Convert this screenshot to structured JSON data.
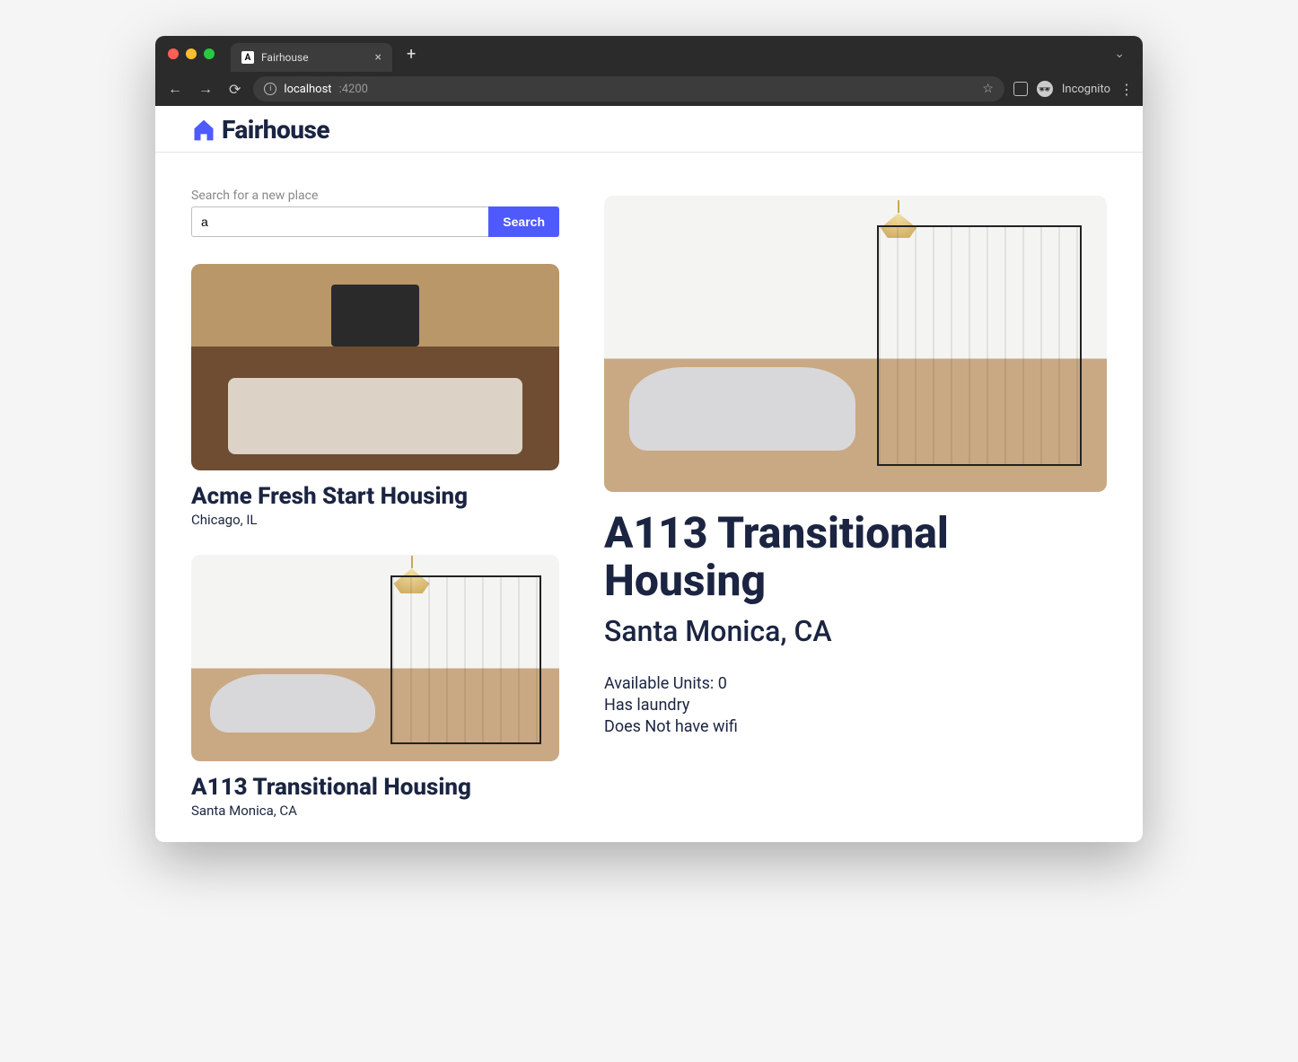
{
  "browser": {
    "tab_title": "Fairhouse",
    "tab_favicon_letter": "A",
    "url_host": "localhost",
    "url_port": ":4200",
    "incognito_label": "Incognito"
  },
  "app": {
    "brand": "Fairhouse"
  },
  "search": {
    "label": "Search for a new place",
    "value": "a",
    "button": "Search"
  },
  "listings": [
    {
      "name": "Acme Fresh Start Housing",
      "location": "Chicago, IL",
      "thumb": "room-a"
    },
    {
      "name": "A113 Transitional Housing",
      "location": "Santa Monica, CA",
      "thumb": "room-b"
    }
  ],
  "detail": {
    "name": "A113 Transitional Housing",
    "location": "Santa Monica, CA",
    "available_units_label": "Available Units: ",
    "available_units_value": "0",
    "laundry_line": "Has laundry",
    "wifi_line": "Does Not have wifi",
    "thumb": "room-b"
  }
}
